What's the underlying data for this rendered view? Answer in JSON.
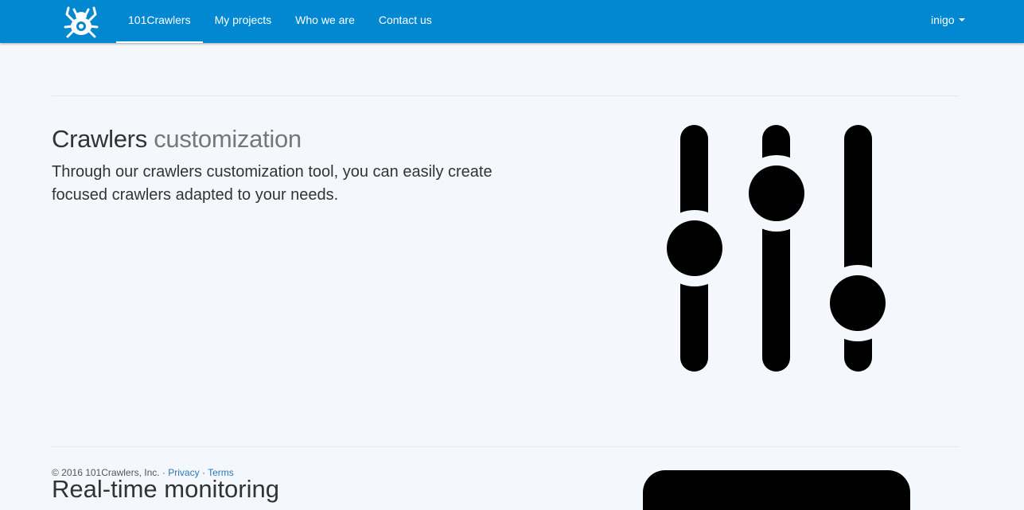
{
  "navbar": {
    "brand_icon": "spider-logo-icon",
    "items": [
      {
        "label": "101Crawlers",
        "active": true
      },
      {
        "label": "My projects",
        "active": false
      },
      {
        "label": "Who we are",
        "active": false
      },
      {
        "label": "Contact us",
        "active": false
      }
    ],
    "user": {
      "label": "inigo",
      "icon": "caret-down-icon"
    }
  },
  "feature": {
    "title_main": "Crawlers",
    "title_muted": "customization",
    "description": "Through our crawlers customization tool, you can easily create focused crawlers adapted to your needs.",
    "icon": "sliders-icon"
  },
  "footer": {
    "copyright": "© 2016 101Crawlers, Inc. ·",
    "privacy_label": "Privacy",
    "separator": "·",
    "terms_label": "Terms"
  },
  "next_feature": {
    "title_partial": "Real-time monitoring"
  },
  "colors": {
    "navbar": "#0288d1",
    "background": "#f4f8fd",
    "link": "#2a77b6"
  }
}
